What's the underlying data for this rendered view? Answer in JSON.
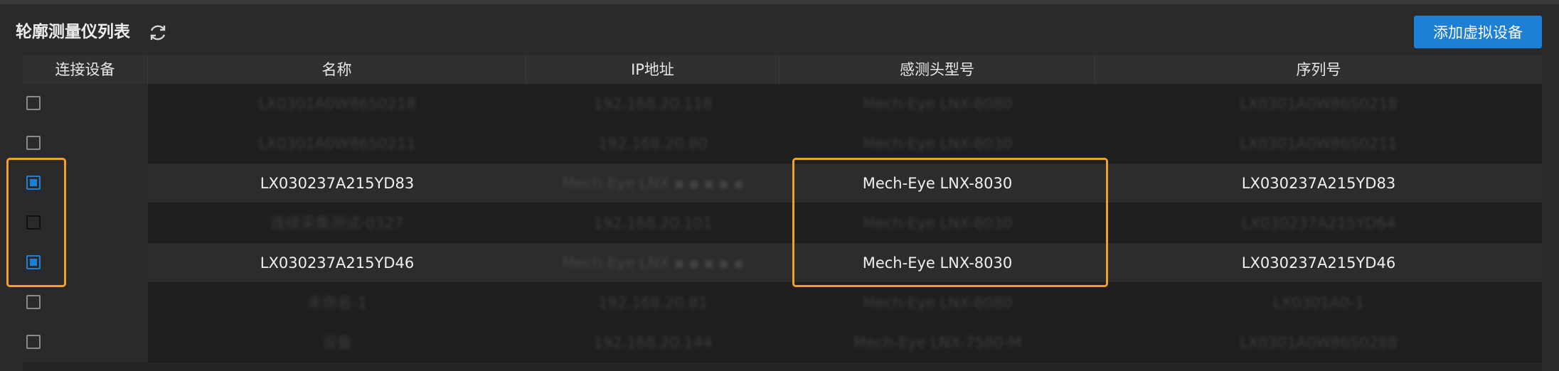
{
  "panel": {
    "title": "轮廓测量仪列表",
    "refresh_icon": "refresh-icon",
    "add_button": "添加虚拟设备"
  },
  "table": {
    "columns": [
      "连接设备",
      "名称",
      "IP地址",
      "感测头型号",
      "序列号"
    ],
    "rows": [
      {
        "checked": false,
        "dim": true,
        "name": "LX0301A0W86S0218",
        "ip": "192.168.20.118",
        "model": "Mech-Eye LNX-8080",
        "serial": "LX0301A0W86S0218"
      },
      {
        "checked": false,
        "dim": true,
        "name": "LX0301A0W86S0211",
        "ip": "192.168.20.80",
        "model": "Mech-Eye LNX-8030",
        "serial": "LX0301A0W86S0211"
      },
      {
        "checked": true,
        "dim": false,
        "name": "LX030237A215YD83",
        "ip": "",
        "model": "Mech-Eye LNX-8030",
        "serial": "LX030237A215YD83"
      },
      {
        "checked": false,
        "dim": true,
        "name": "连续采集测试-0327",
        "ip": "192.168.20.101",
        "model": "Mech-Eye LNX-8030",
        "serial": "LX030237A215YD64"
      },
      {
        "checked": true,
        "dim": false,
        "name": "LX030237A215YD46",
        "ip": "",
        "model": "Mech-Eye LNX-8030",
        "serial": "LX030237A215YD46"
      },
      {
        "checked": false,
        "dim": true,
        "name": "未命名-1",
        "ip": "192.168.20.81",
        "model": "Mech-Eye LNX-8080",
        "serial": "LX0301A0-1"
      },
      {
        "checked": false,
        "dim": true,
        "name": "设备",
        "ip": "192.168.20.144",
        "model": "Mech-Eye LNX-7580-M",
        "serial": "LX0301A0W86S0288"
      }
    ]
  },
  "colors": {
    "accent": "#1d7fd6",
    "highlight": "#f0a126"
  }
}
